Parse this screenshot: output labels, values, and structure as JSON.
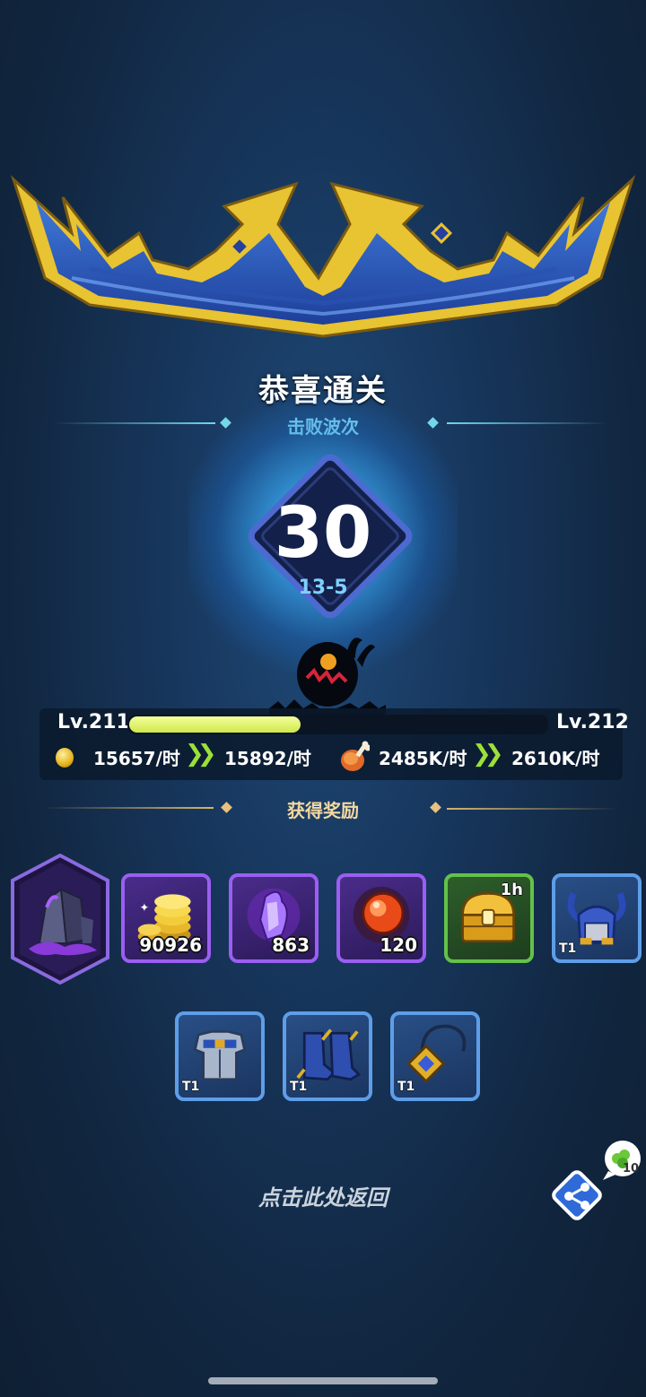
{
  "header": {
    "title": "恭喜通关",
    "waves_label": "击败波次"
  },
  "result": {
    "waves": "30",
    "stage": "13-5"
  },
  "level": {
    "current": "Lv.211",
    "next": "Lv.212",
    "progress": 0.41
  },
  "income": {
    "gold_current": "15657/时",
    "gold_next": "15892/时",
    "food_current": "2485K/时",
    "food_next": "2610K/时",
    "arrow_glyph": "❯❯"
  },
  "rewards": {
    "label": "获得奖励",
    "row1": [
      {
        "icon": "dark-crystal-icon",
        "qty": ""
      },
      {
        "icon": "gold-coins-icon",
        "qty": "90926"
      },
      {
        "icon": "purple-gem-icon",
        "qty": "863"
      },
      {
        "icon": "fire-orb-icon",
        "qty": "120"
      },
      {
        "icon": "treasure-chest-icon",
        "tag": "1h"
      },
      {
        "icon": "horned-helmet-icon",
        "tag": "T1"
      }
    ],
    "row2": [
      {
        "icon": "chest-armor-icon",
        "tag": "T1"
      },
      {
        "icon": "spiked-boots-icon",
        "tag": "T1"
      },
      {
        "icon": "amulet-icon",
        "tag": "T1"
      }
    ]
  },
  "footer": {
    "back_label": "点击此处返回",
    "bubble_count": "10"
  },
  "colors": {
    "accent_cyan": "#74d6ea",
    "accent_gold": "#d9b36a",
    "xp_fill": "#cfe84c",
    "arrow_green": "#9be03a"
  }
}
